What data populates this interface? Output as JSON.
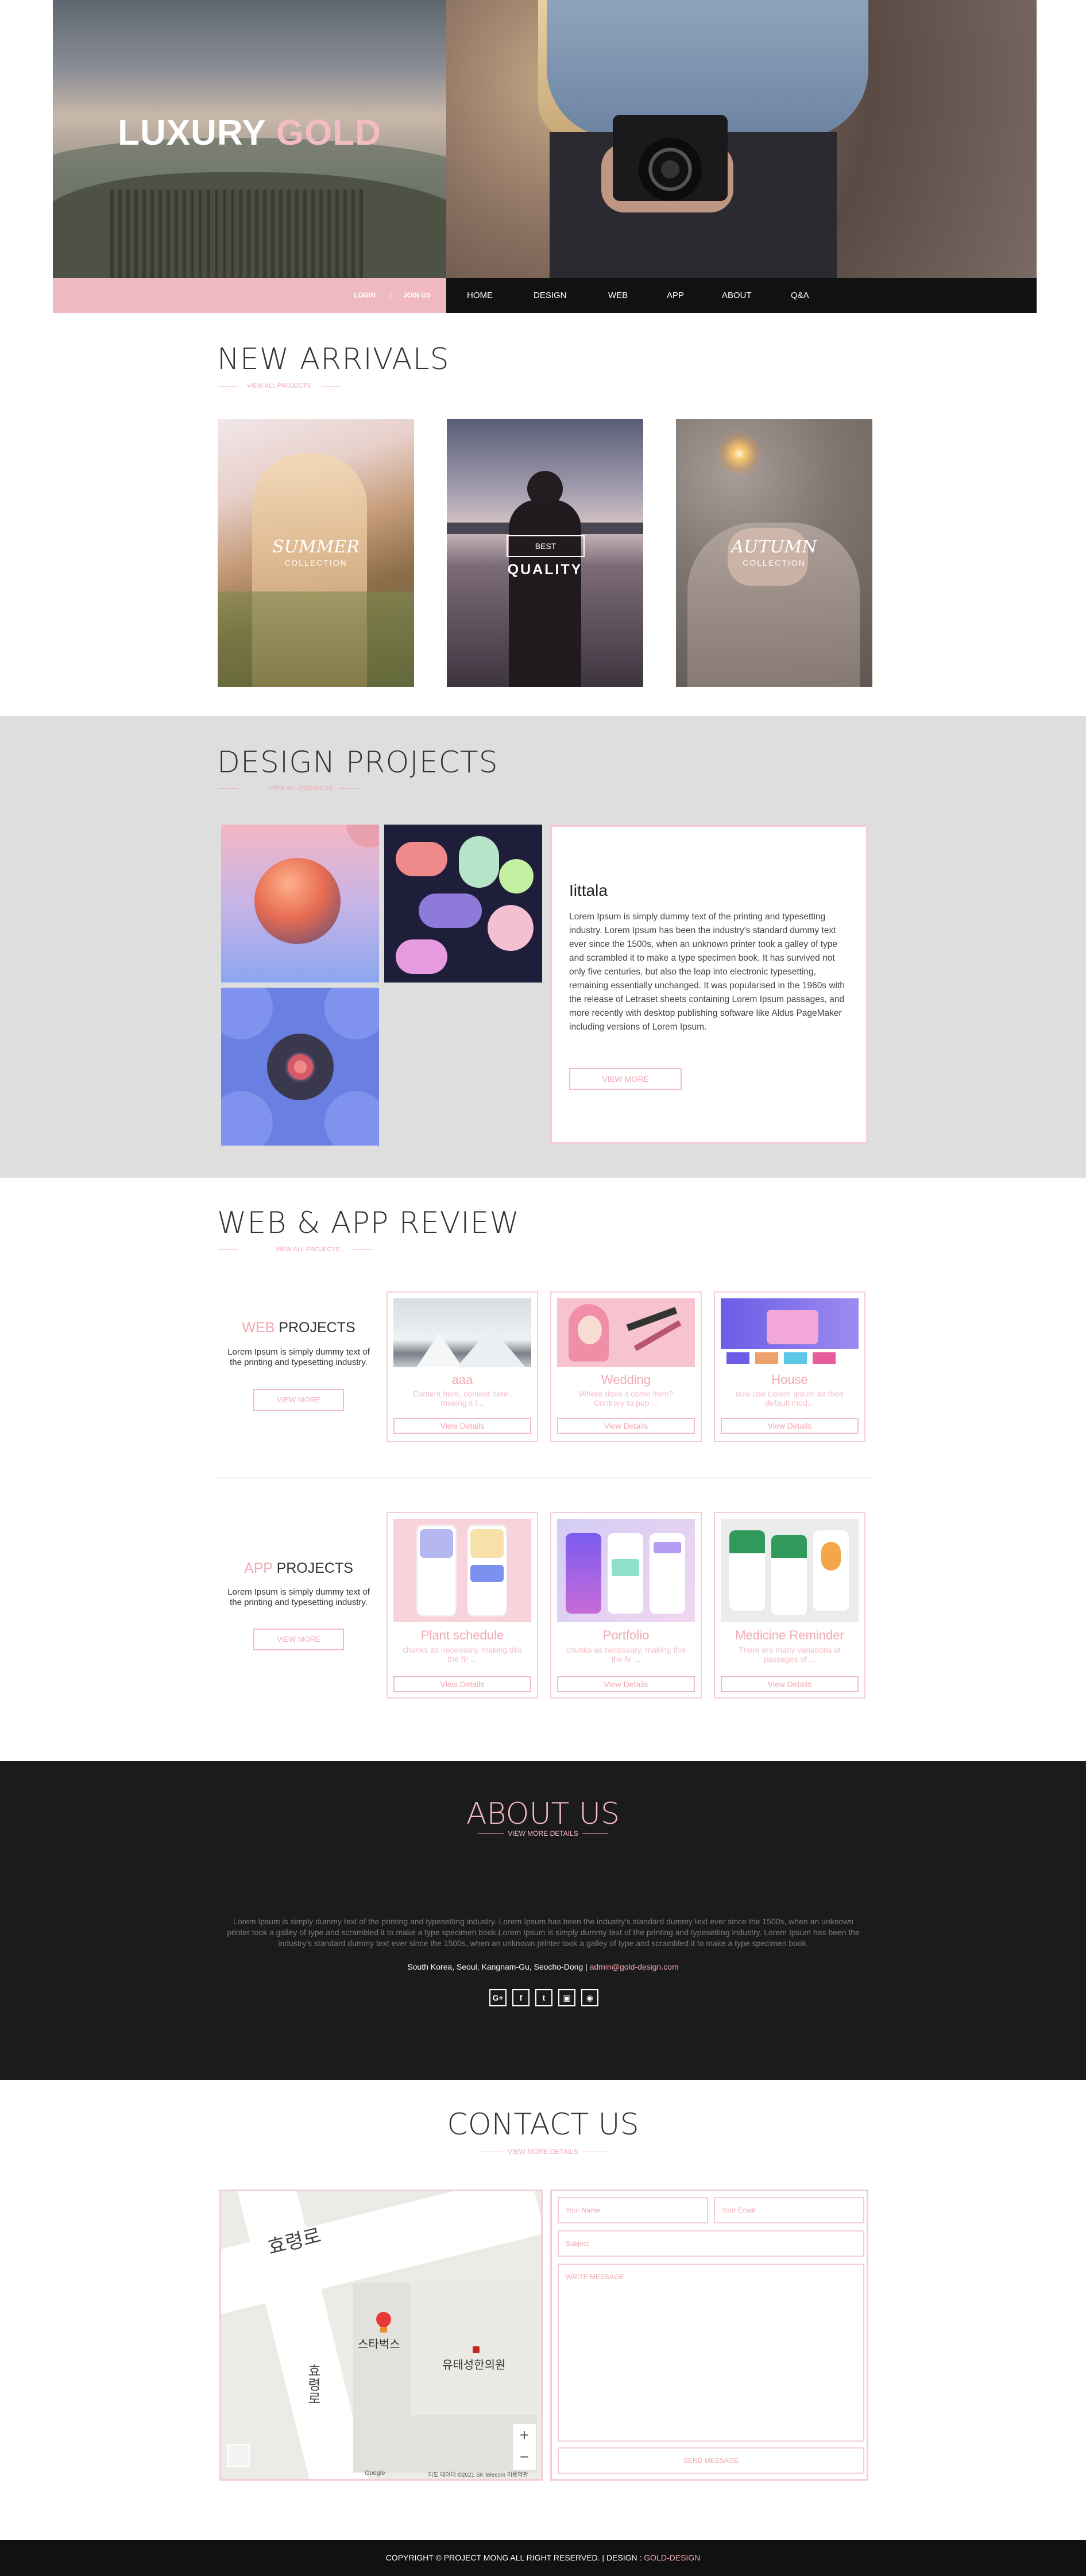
{
  "hero": {
    "title_white": "LUXURY",
    "title_pink": "GOLD",
    "login": "LOGIN",
    "separator": "|",
    "join": "JOIN US",
    "nav": [
      "HOME",
      "DESIGN",
      "WEB",
      "APP",
      "ABOUT",
      "Q&A"
    ]
  },
  "arrivals": {
    "title": "NEW ARRIVALS",
    "subtitle": "VIEW ALL PROJECTS",
    "cards": [
      {
        "script": "SUMMER",
        "sub": "COLLECTION"
      },
      {
        "badge": "BEST",
        "main": "QUALITY"
      },
      {
        "script": "AUTUMN",
        "sub": "COLLECTION"
      }
    ]
  },
  "design": {
    "title": "DESIGN PROJECTS",
    "subtitle": "VIEW ALL PROJECTS",
    "card_title": "Iittala",
    "card_body": "Lorem Ipsum is simply dummy text of the printing and typesetting industry. Lorem Ipsum has been the industry's standard dummy text ever since the 1500s, when an unknown printer took a galley of type and scrambled it to make a type specimen book. It has survived not only five centuries, but also the leap into electronic typesetting, remaining essentially unchanged. It was popularised in the 1960s with the release of Letraset sheets containing Lorem Ipsum passages, and more recently with desktop publishing software like Aldus PageMaker including versions of Lorem Ipsum.",
    "card_button": "VIEW MORE"
  },
  "webapp": {
    "title": "WEB & APP REVIEW",
    "subtitle": "VIEW ALL PROJECTS",
    "web": {
      "title_pink": "WEB",
      "title_dark": "PROJECTS",
      "body": "Lorem Ipsum is simply dummy text of the printing and typesetting industry.",
      "button": "VIEW MORE",
      "cards": [
        {
          "title": "aaa",
          "desc": "Content here, content here', making it l...",
          "button": "View Details"
        },
        {
          "title": "Wedding",
          "desc": "Where does it come from? Contrary to pop ...",
          "button": "View Details"
        },
        {
          "title": "House",
          "desc": "now use Lorem Ipsum as their default mod...",
          "button": "View Details"
        }
      ]
    },
    "app": {
      "title_pink": "APP",
      "title_dark": "PROJECTS",
      "body": "Lorem Ipsum is simply dummy text of the printing and typesetting industry.",
      "button": "VIEW MORE",
      "cards": [
        {
          "title": "Plant schedule",
          "desc": "chunks as necessary, making this the fir ...",
          "button": "View Details"
        },
        {
          "title": "Portfolio",
          "desc": "chunks as necessary, making this the fir ...",
          "button": "View Details"
        },
        {
          "title": "Medicine Reminder",
          "desc": "There are many variations of passages of ...",
          "button": "View Details"
        }
      ]
    }
  },
  "about": {
    "title": "ABOUT US",
    "subtitle": "VIEW MORE DETAILS",
    "body": "Lorem Ipsum is simply dummy text of the printing and typesetting industry. Lorem Ipsum has been the industry's standard dummy text ever since the 1500s, when an unknown printer took a galley of type and scrambled it to make a type specimen book.Lorem Ipsum is simply dummy text of the printing and typesetting industry. Lorem Ipsum has been the industry's standard dummy text ever since the 1500s, when an unknown printer took a galley of type and scrambled it to make a type specimen book.",
    "address": "South Korea, Seoul, Kangnam-Gu, Seocho-Dong",
    "sep": "|",
    "email": "admin@gold-design.com",
    "social": [
      "G+",
      "f",
      "t",
      "▣",
      "◉"
    ]
  },
  "contact": {
    "title": "CONTACT US",
    "subtitle": "VIEW MORE DETAILS",
    "name_placeholder": "Your Name",
    "email_placeholder": "Your Email",
    "subject_placeholder": "Subject",
    "message_placeholder": "WRITE MESSAGE",
    "send": "SEND MESSAGE",
    "map": {
      "road1": "효령로",
      "road2": "효령로",
      "place1": "스타벅스",
      "place2": "유태성한의원",
      "google": "Google",
      "attribution": "지도 데이터 ©2021 SK telecom   이용약관",
      "zoom_in": "+",
      "zoom_out": "−"
    }
  },
  "footer": {
    "text": "COPYRIGHT © PROJECT MONG ALL RIGHT RESERVED.  |  DESIGN :",
    "brand": "GOLD-DESIGN"
  }
}
